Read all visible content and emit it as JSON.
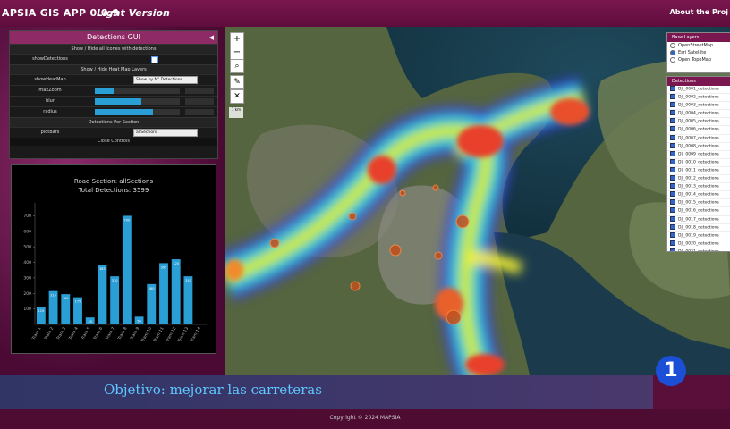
{
  "header": {
    "title": "APSIA GIS APP 0.0.9",
    "version": "Light Version",
    "about": "About the Proj"
  },
  "gui": {
    "title": "Detections GUI",
    "collapse_icon": "triangle-left-icon",
    "section_show_hide": "Show / Hide all Icones with detections",
    "show_detections_label": "showDetections",
    "show_detections_checked": true,
    "section_heatmap": "Show / Hide Heat Map Layers",
    "show_heatmap_label": "showHeatMap",
    "show_heatmap_value": "Show by N° Detections",
    "max_zoom_label": "maxZoom",
    "max_zoom_fraction": 0.22,
    "blur_label": "blur",
    "blur_fraction": 0.55,
    "radius_label": "radius",
    "radius_fraction": 0.68,
    "section_per_section": "Detections Per Section",
    "plot_bars_label": "plotBars",
    "plot_bars_value": "allSections",
    "close_label": "Close Controls"
  },
  "chart_data": {
    "type": "bar",
    "title": "Road Section: allSections",
    "subtitle": "Total Detections: 3599",
    "categories": [
      "Tram 1",
      "Tram 2",
      "Tram 3",
      "Tram 4",
      "Tram 5",
      "Tram 6",
      "Tram 7",
      "Tram 8",
      "Tram 9",
      "Tram 10",
      "Tram 11",
      "Tram 12",
      "Tram 13",
      "Tram 14"
    ],
    "values": [
      115,
      215,
      195,
      175,
      45,
      385,
      310,
      700,
      50,
      260,
      395,
      420,
      310,
      0
    ],
    "yticks": [
      100,
      200,
      300,
      400,
      500,
      600,
      700
    ],
    "ylim": [
      0,
      760
    ],
    "color": "#2a9fd6"
  },
  "map": {
    "zoom_in": "+",
    "zoom_out": "−",
    "scale_label": "1 km"
  },
  "base_layers": {
    "title": "Base Layers",
    "options": [
      "OpenStreetMap",
      "Esri Satellite",
      "Open TopoMap"
    ],
    "selected": 1
  },
  "detections_panel": {
    "title": "Detections",
    "items": [
      "DJI_0001_detections",
      "DJI_0002_detections",
      "DJI_0003_detections",
      "DJI_0004_detections",
      "DJI_0005_detections",
      "DJI_0006_detections",
      "DJI_0007_detections",
      "DJI_0008_detections",
      "DJI_0009_detections",
      "DJI_0010_detections",
      "DJI_0011_detections",
      "DJI_0012_detections",
      "DJI_0013_detections",
      "DJI_0014_detections",
      "DJI_0015_detections",
      "DJI_0016_detections",
      "DJI_0017_detections",
      "DJI_0018_detections",
      "DJI_0019_detections",
      "DJI_0020_detections",
      "DJI_0021_detections"
    ]
  },
  "caption": {
    "text": "Objetivo: mejorar las carreteras",
    "logo": "1"
  },
  "footer": {
    "copyright": "Copyright © 2024 MAPSIA"
  }
}
